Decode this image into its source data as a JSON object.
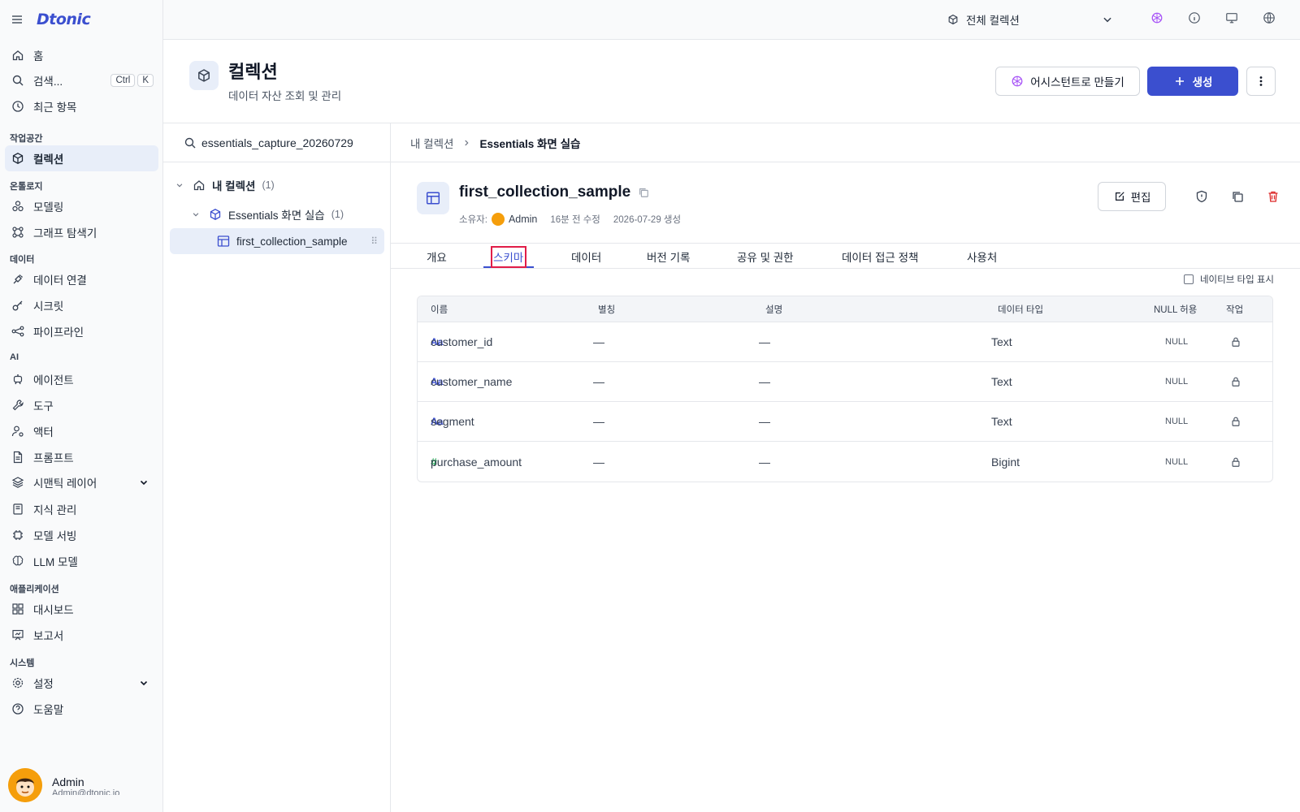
{
  "brand": "Dtonic",
  "nav": {
    "home": "홈",
    "search": "검색...",
    "search_kbd": [
      "Ctrl",
      "K"
    ],
    "recent": "최근 항목",
    "sections": {
      "workspace": "작업공간",
      "ontology": "온톨로지",
      "data": "데이터",
      "ai": "AI",
      "apps": "애플리케이션",
      "system": "시스템"
    },
    "collection": "컬렉션",
    "modeling": "모델링",
    "graph_explorer": "그래프 탐색기",
    "data_connection": "데이터 연결",
    "secret": "시크릿",
    "pipeline": "파이프라인",
    "agent": "에이전트",
    "tool": "도구",
    "actor": "액터",
    "prompt": "프롬프트",
    "semantic_layer": "시맨틱 레이어",
    "knowledge": "지식 관리",
    "model_serving": "모델 서빙",
    "llm_model": "LLM 모델",
    "dashboard": "대시보드",
    "report": "보고서",
    "settings": "설정",
    "help": "도움말"
  },
  "user": {
    "name": "Admin",
    "email": "Admin@dtonic.io"
  },
  "topbar": {
    "collection_scope": "전체 컬렉션"
  },
  "header": {
    "title": "컬렉션",
    "subtitle": "데이터 자산 조회 및 관리",
    "assist_btn": "어시스턴트로 만들기",
    "create_btn": "생성"
  },
  "tree": {
    "search_value": "essentials_capture_20260729",
    "root": {
      "label": "내 컬렉션",
      "count": "(1)"
    },
    "child": {
      "label": "Essentials 화면 실습",
      "count": "(1)"
    },
    "leaf": {
      "label": "first_collection_sample"
    }
  },
  "detail": {
    "breadcrumb": [
      "내 컬렉션",
      "Essentials 화면 실습"
    ],
    "title": "first_collection_sample",
    "owner_label": "소유자:",
    "owner": "Admin",
    "modified": "16분 전 수정",
    "created": "2026-07-29 생성",
    "edit_btn": "편집",
    "tabs": [
      "개요",
      "스키마",
      "데이터",
      "버전 기록",
      "공유 및 권한",
      "데이터 접근 정책",
      "사용처"
    ],
    "active_tab": "스키마",
    "native_type_label": "네이티브 타입 표시"
  },
  "schema": {
    "columns": [
      "이름",
      "별칭",
      "설명",
      "데이터 타입",
      "NULL 허용",
      "작업"
    ],
    "rows": [
      {
        "icon": "text-type-icon",
        "name": "customer_id",
        "alias": "—",
        "desc": "—",
        "type": "Text",
        "nullable": "NULL"
      },
      {
        "icon": "text-type-icon",
        "name": "customer_name",
        "alias": "—",
        "desc": "—",
        "type": "Text",
        "nullable": "NULL"
      },
      {
        "icon": "text-type-icon",
        "name": "segment",
        "alias": "—",
        "desc": "—",
        "type": "Text",
        "nullable": "NULL"
      },
      {
        "icon": "number-type-icon",
        "name": "purchase_amount",
        "alias": "—",
        "desc": "—",
        "type": "Bigint",
        "nullable": "NULL"
      }
    ]
  },
  "colors": {
    "accent": "#3b4fcf",
    "danger": "#dc2626",
    "highlight": "#e11d48"
  }
}
